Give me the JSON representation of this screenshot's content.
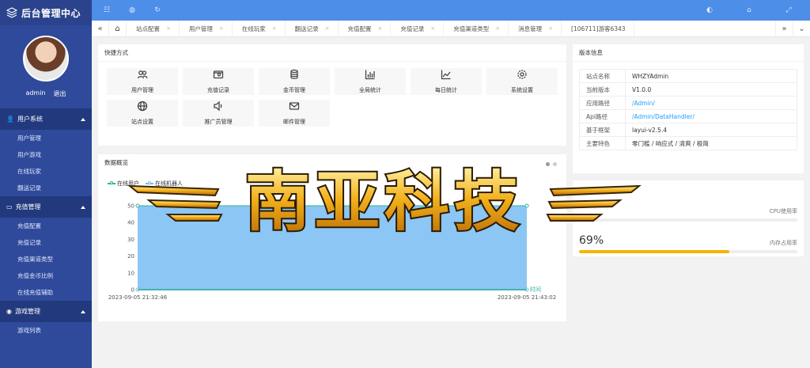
{
  "brand": {
    "title": "后台管理中心"
  },
  "user": {
    "name": "admin",
    "logout": "退出"
  },
  "menu": [
    {
      "title": "用户系统",
      "items": [
        "用户管理",
        "用户游戏",
        "在线玩家",
        "翻送记录"
      ]
    },
    {
      "title": "充值管理",
      "items": [
        "充值配置",
        "充值记录",
        "充值渠道类型",
        "充值金币比例",
        "在线充值辅助"
      ]
    },
    {
      "title": "游戏管理",
      "items": [
        "游戏列表"
      ]
    }
  ],
  "tabs": [
    "站点配置",
    "用户管理",
    "在线玩家",
    "翻送记录",
    "充值配置",
    "充值记录",
    "充值渠道类型",
    "消息管理",
    "[106711]游客6343"
  ],
  "quick": {
    "title": "快捷方式",
    "items": [
      {
        "label": "用户管理",
        "icon": "users-icon"
      },
      {
        "label": "充值记录",
        "icon": "wallet-icon"
      },
      {
        "label": "金币管理",
        "icon": "coins-icon"
      },
      {
        "label": "全局统计",
        "icon": "bar-chart-icon"
      },
      {
        "label": "每日统计",
        "icon": "line-chart-icon"
      },
      {
        "label": "系统设置",
        "icon": "gear-icon"
      },
      {
        "label": "站点设置",
        "icon": "globe-icon"
      },
      {
        "label": "推广员管理",
        "icon": "speaker-icon"
      },
      {
        "label": "邮件管理",
        "icon": "mail-icon"
      }
    ]
  },
  "overview": {
    "title": "数据概览"
  },
  "version": {
    "title": "版本信息",
    "rows": [
      {
        "k": "站点名称",
        "v": "WHZYAdmin",
        "link": false
      },
      {
        "k": "当前版本",
        "v": "V1.0.0",
        "link": false
      },
      {
        "k": "应用路径",
        "v": "/Admin/",
        "link": true
      },
      {
        "k": "Api路径",
        "v": "/Admin/DataHandler/",
        "link": true
      },
      {
        "k": "基于框架",
        "v": "layui-v2.5.4",
        "link": false
      },
      {
        "k": "主要特色",
        "v": "零门槛 / 响应式 / 清爽 / 极简",
        "link": false
      }
    ]
  },
  "sysload": {
    "metrics": [
      {
        "label": "CPU使用率",
        "value_text": "",
        "value": 0
      },
      {
        "label": "内存占用率",
        "value_text": "69%",
        "value": 69
      }
    ]
  },
  "watermark": {
    "text": "南亚科技"
  },
  "chart_data": {
    "type": "area",
    "series": [
      {
        "name": "在线用户",
        "color": "#2fb39a",
        "values": [
          50,
          50
        ]
      },
      {
        "name": "在线机器人",
        "color": "#7cb5ec",
        "values": [
          0,
          0
        ]
      }
    ],
    "x": [
      "2023-09-05 21:32:46",
      "2023-09-05 21:43:02"
    ],
    "xlabel": "时间",
    "ylim": [
      0,
      50
    ],
    "yticks": [
      0,
      10,
      20,
      30,
      40,
      50
    ]
  }
}
